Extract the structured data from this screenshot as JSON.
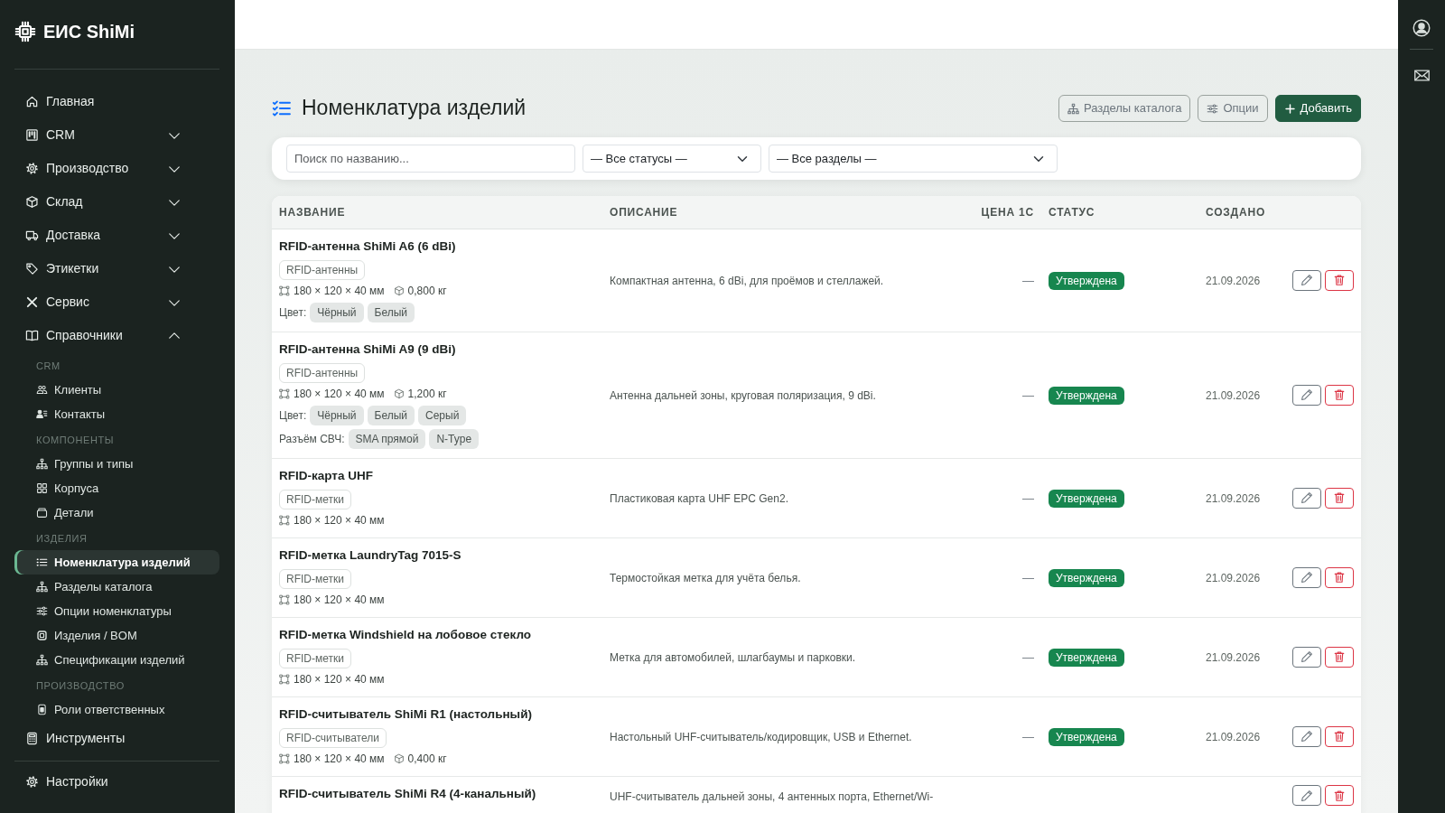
{
  "brand": {
    "name": "ЕИС ShiMi"
  },
  "sidebar": {
    "items": [
      {
        "kind": "link",
        "label": "Главная",
        "selected": false
      },
      {
        "kind": "menu",
        "label": "CRM",
        "expanded": false
      },
      {
        "kind": "menu",
        "label": "Производство",
        "expanded": false
      },
      {
        "kind": "menu",
        "label": "Склад",
        "expanded": false
      },
      {
        "kind": "menu",
        "label": "Доставка",
        "expanded": false
      },
      {
        "kind": "menu",
        "label": "Этикетки",
        "expanded": false
      },
      {
        "kind": "menu",
        "label": "Сервис",
        "expanded": false
      },
      {
        "kind": "menu",
        "label": "Справочники",
        "expanded": true,
        "sections": [
          {
            "heading": "CRM",
            "children": [
              {
                "label": "Клиенты",
                "selected": false
              },
              {
                "label": "Контакты",
                "selected": false
              }
            ]
          },
          {
            "heading": "КОМПОНЕНТЫ",
            "children": [
              {
                "label": "Группы и типы",
                "selected": false
              },
              {
                "label": "Корпуса",
                "selected": false
              },
              {
                "label": "Детали",
                "selected": false
              }
            ]
          },
          {
            "heading": "ИЗДЕЛИЯ",
            "children": [
              {
                "label": "Номенклатура изделий",
                "selected": true
              },
              {
                "label": "Разделы каталога",
                "selected": false
              },
              {
                "label": "Опции номенклатуры",
                "selected": false
              },
              {
                "label": "Изделия / BOM",
                "selected": false
              },
              {
                "label": "Спецификации изделий",
                "selected": false
              }
            ]
          },
          {
            "heading": "ПРОИЗВОДСТВО",
            "children": [
              {
                "label": "Роли ответственных",
                "selected": false
              }
            ]
          }
        ]
      },
      {
        "kind": "link",
        "label": "Инструменты",
        "selected": false
      }
    ],
    "footer": [
      {
        "label": "Настройки",
        "selected": false
      }
    ]
  },
  "page": {
    "title": "Номенклатура изделий",
    "actions": [
      {
        "kind": "outline",
        "label": "Разделы каталога"
      },
      {
        "kind": "outline",
        "label": "Опции"
      },
      {
        "kind": "primary",
        "label": "Добавить"
      }
    ]
  },
  "filters": {
    "search": {
      "placeholder": "Поиск по названию..."
    },
    "status": {
      "value": "— Все статусы —"
    },
    "section": {
      "value": "— Все разделы —"
    }
  },
  "table": {
    "columns": [
      "НАЗВАНИЕ",
      "ОПИСАНИЕ",
      "ЦЕНА 1С",
      "СТАТУС",
      "СОЗДАНО"
    ],
    "rows": [
      {
        "name": "RFID-антенна ShiMi A6 (6 dBi)",
        "category": "RFID-антенны",
        "dimensions": "180 × 120 × 40 мм",
        "weight": "0,800 кг",
        "options": [
          {
            "label": "Цвет:",
            "values": [
              "Чёрный",
              "Белый"
            ]
          }
        ],
        "description": "Компактная антенна, 6 dBi, для проёмов и стеллажей.",
        "price": "—",
        "status": "Утверждена",
        "created": "21.09.2026"
      },
      {
        "name": "RFID-антенна ShiMi A9 (9 dBi)",
        "category": "RFID-антенны",
        "dimensions": "180 × 120 × 40 мм",
        "weight": "1,200 кг",
        "options": [
          {
            "label": "Цвет:",
            "values": [
              "Чёрный",
              "Белый",
              "Серый"
            ]
          },
          {
            "label": "Разъём СВЧ:",
            "values": [
              "SMA прямой",
              "N-Type"
            ]
          }
        ],
        "description": "Антенна дальней зоны, круговая поляризация, 9 dBi.",
        "price": "—",
        "status": "Утверждена",
        "created": "21.09.2026"
      },
      {
        "name": "RFID-карта UHF",
        "category": "RFID-метки",
        "dimensions": "180 × 120 × 40 мм",
        "description": "Пластиковая карта UHF EPC Gen2.",
        "price": "—",
        "status": "Утверждена",
        "created": "21.09.2026"
      },
      {
        "name": "RFID-метка LaundryTag 7015-S",
        "category": "RFID-метки",
        "dimensions": "180 × 120 × 40 мм",
        "description": "Термостойкая метка для учёта белья.",
        "price": "—",
        "status": "Утверждена",
        "created": "21.09.2026"
      },
      {
        "name": "RFID-метка Windshield на лобовое стекло",
        "category": "RFID-метки",
        "dimensions": "180 × 120 × 40 мм",
        "description": "Метка для автомобилей, шлагбаумы и парковки.",
        "price": "—",
        "status": "Утверждена",
        "created": "21.09.2026"
      },
      {
        "name": "RFID-считыватель ShiMi R1 (настольный)",
        "category": "RFID-считыватели",
        "dimensions": "180 × 120 × 40 мм",
        "weight": "0,400 кг",
        "description": "Настольный UHF-считыватель/кодировщик, USB и Ethernet.",
        "price": "—",
        "status": "Утверждена",
        "created": "21.09.2026"
      },
      {
        "name": "RFID-считыватель ShiMi R4 (4-канальный)",
        "description": "UHF-считыватель дальней зоны, 4 антенных порта, Ethernet/Wi-"
      }
    ]
  }
}
